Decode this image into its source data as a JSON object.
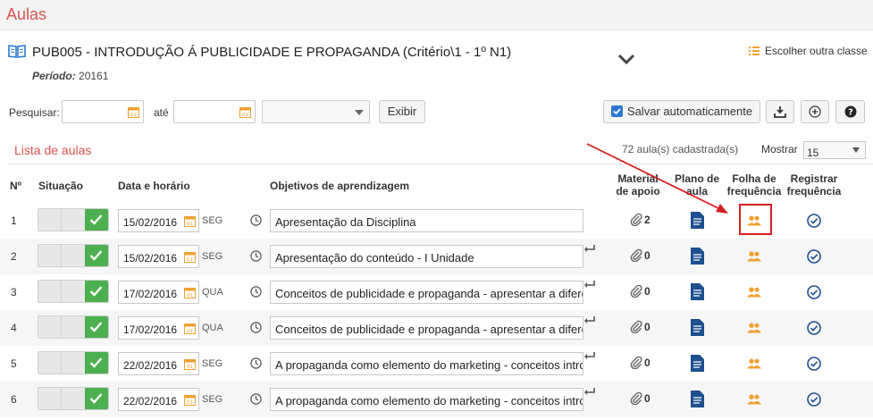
{
  "page": {
    "title": "Aulas"
  },
  "course": {
    "title": "PUB005 - INTRODUÇÃO Á PUBLICIDADE E PROPAGANDA (Critério\\1 - 1º N1)",
    "period_label": "Período:",
    "period_value": "20161",
    "choose_other": "Escolher outra classe"
  },
  "filter": {
    "search_label": "Pesquisar:",
    "to_label": "até",
    "show_button": "Exibir",
    "auto_save": "Salvar automaticamente",
    "icons": [
      "download-icon",
      "add-circle-icon",
      "help-icon"
    ]
  },
  "list": {
    "title": "Lista de aulas",
    "count": "72 aula(s) cadastrada(s)",
    "show_label": "Mostrar",
    "show_value": "15"
  },
  "table": {
    "headers": {
      "num": "Nº",
      "status": "Situação",
      "date": "Data e horário",
      "objectives": "Objetivos de aprendizagem",
      "material": "Material de apoio",
      "plan": "Plano de aula",
      "attendance_sheet": "Folha de frequência",
      "register": "Registrar frequência"
    },
    "rows": [
      {
        "n": "1",
        "date": "15/02/2016",
        "day": "SEG",
        "objective": "Apresentação da Disciplina",
        "material": "2"
      },
      {
        "n": "2",
        "date": "15/02/2016",
        "day": "SEG",
        "objective": "Apresentação do conteúdo - I Unidade",
        "material": "0"
      },
      {
        "n": "3",
        "date": "17/02/2016",
        "day": "QUA",
        "objective": "Conceitos de publicidade e propaganda - apresentar a diferença",
        "material": "0"
      },
      {
        "n": "4",
        "date": "17/02/2016",
        "day": "QUA",
        "objective": "Conceitos de publicidade e propaganda - apresentar a diferença",
        "material": "0"
      },
      {
        "n": "5",
        "date": "22/02/2016",
        "day": "SEG",
        "objective": "A propaganda como elemento do marketing - conceitos introdutórios",
        "material": "0"
      },
      {
        "n": "6",
        "date": "22/02/2016",
        "day": "SEG",
        "objective": "A propaganda como elemento do marketing - conceitos introdutórios",
        "material": "0"
      }
    ]
  },
  "colors": {
    "title_red": "#d9534f",
    "toggle_green": "#4caf50",
    "doc_blue": "#1e4f8f",
    "people_orange": "#f0a030",
    "annotation_red": "#d62020"
  }
}
